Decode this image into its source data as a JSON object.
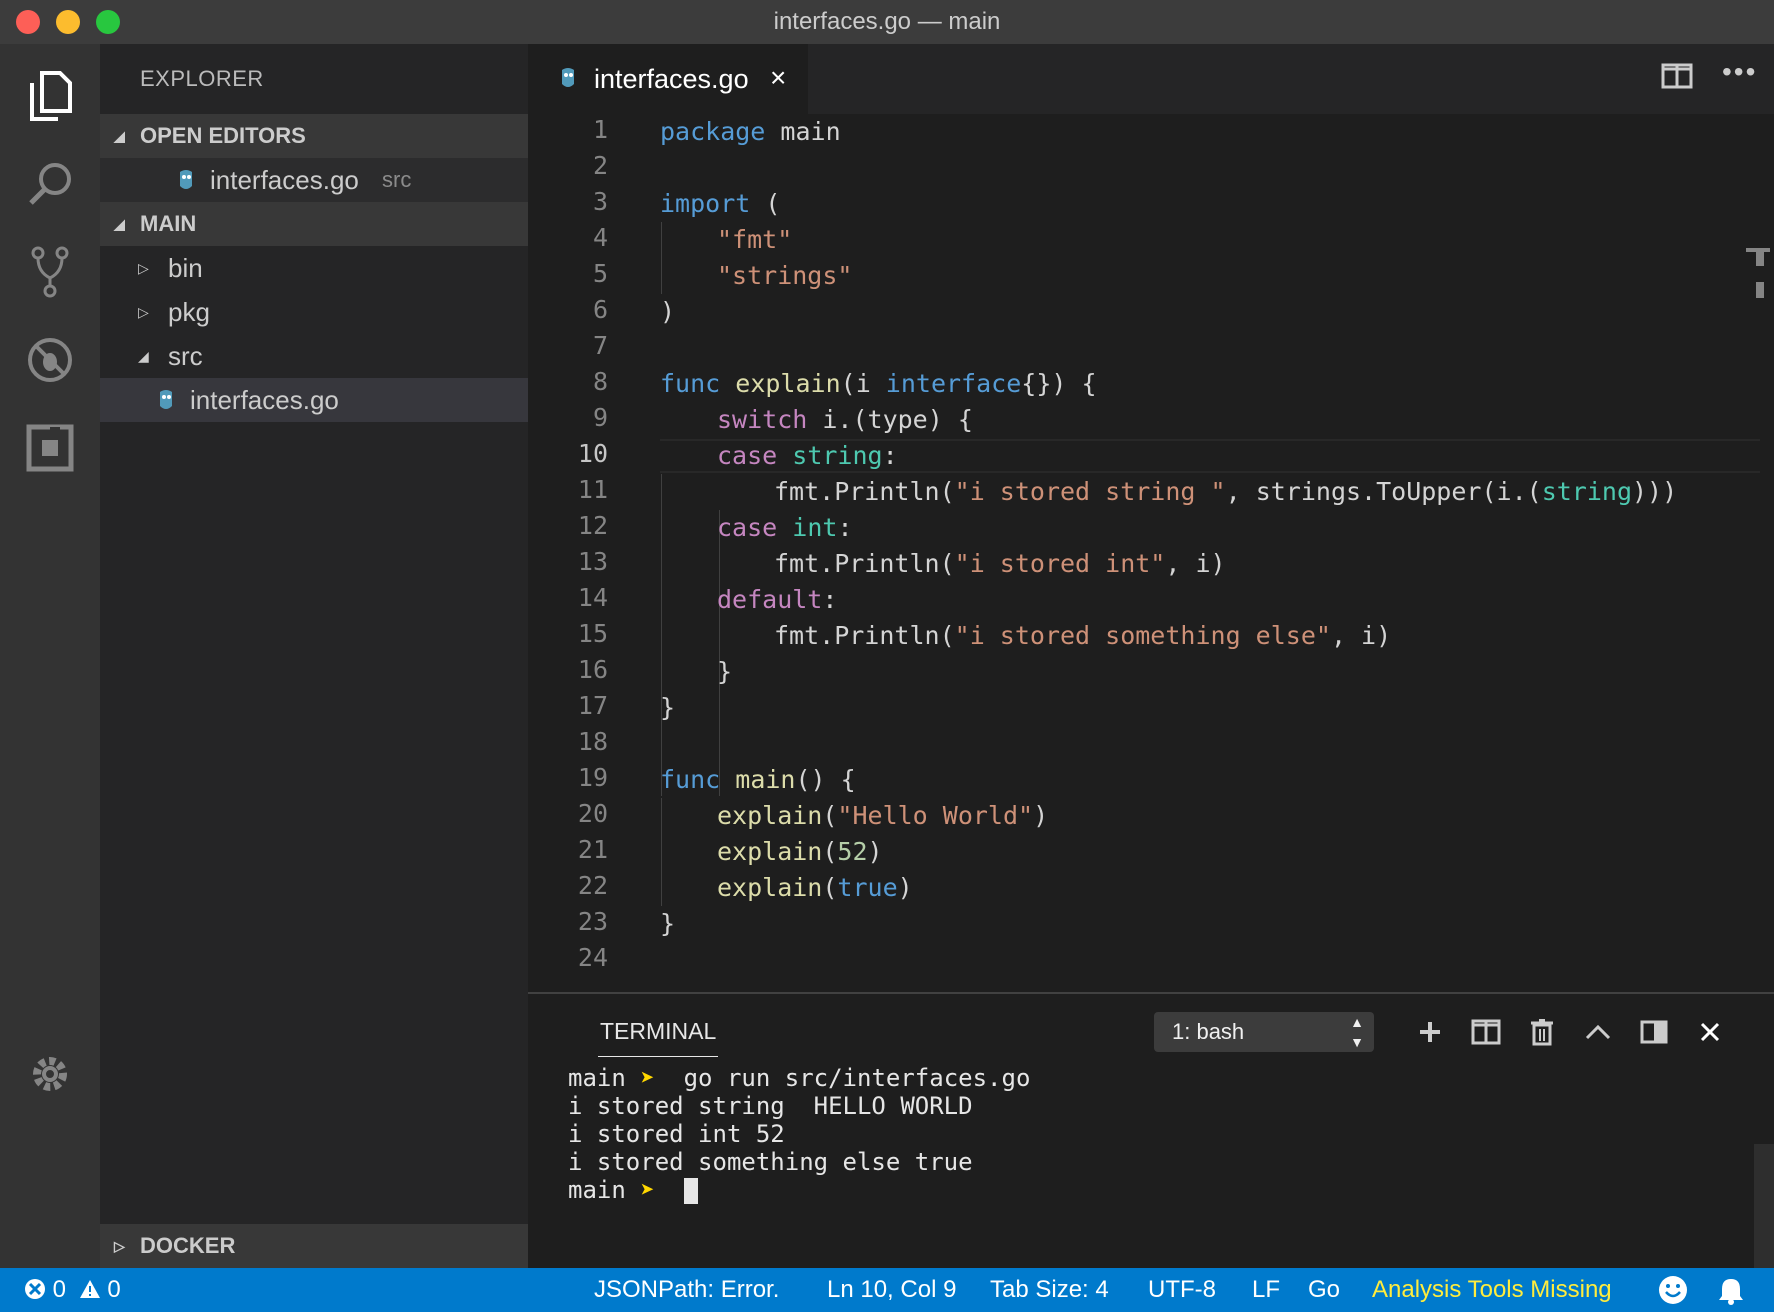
{
  "window": {
    "title": "interfaces.go — main"
  },
  "activity_bar": {
    "items": [
      "files-icon",
      "search-icon",
      "source-control-icon",
      "debug-icon",
      "extensions-icon"
    ],
    "bottom": "gear-icon"
  },
  "sidebar": {
    "title": "EXPLORER",
    "open_editors": {
      "label": "OPEN EDITORS",
      "items": [
        {
          "name": "interfaces.go",
          "folder": "src"
        }
      ]
    },
    "main": {
      "label": "MAIN",
      "items": [
        {
          "name": "bin"
        },
        {
          "name": "pkg"
        },
        {
          "name": "src"
        },
        {
          "name": "interfaces.go"
        }
      ]
    },
    "docker": {
      "label": "DOCKER"
    }
  },
  "editor": {
    "tab": {
      "label": "interfaces.go",
      "close": "×"
    },
    "line_numbers": [
      "1",
      "2",
      "3",
      "4",
      "5",
      "6",
      "7",
      "8",
      "9",
      "10",
      "11",
      "12",
      "13",
      "14",
      "15",
      "16",
      "17",
      "18",
      "19",
      "20",
      "21",
      "22",
      "23",
      "24"
    ],
    "code": [
      "package main",
      "",
      "import (",
      "\"fmt\"",
      "\"strings\"",
      ")",
      "",
      "func explain(i interface{}) {",
      "switch i.(type) {",
      "case string:",
      "fmt.Println(\"i stored string \", strings.ToUpper(i.(string)))",
      "case int:",
      "fmt.Println(\"i stored int\", i)",
      "default:",
      "fmt.Println(\"i stored something else\", i)",
      "}",
      "}",
      "",
      "func main() {",
      "explain(\"Hello World\")",
      "explain(52)",
      "explain(true)",
      "}",
      ""
    ],
    "tokens": {
      "package": "package",
      "main": "main",
      "import": "import",
      "func": "func",
      "explain": "explain",
      "interface": "interface",
      "switch": "switch",
      "case": "case",
      "default": "default",
      "string": "string",
      "int": "int",
      "true": "true",
      "fmt_str": "\"fmt\"",
      "strings_str": "\"strings\"",
      "s_string": "\"i stored string \"",
      "s_int": "\"i stored int\"",
      "s_else": "\"i stored something else\"",
      "s_hello": "\"Hello World\"",
      "n52": "52",
      "println": "fmt.Println",
      "toupper": "strings.ToUpper",
      "main_fn": "main"
    }
  },
  "panel": {
    "tab": "TERMINAL",
    "shell_select": "1: bash",
    "terminal_lines": [
      {
        "prompt": "main",
        "arrow": "➤",
        "cmd": "go run src/interfaces.go"
      },
      {
        "text": "i stored string  HELLO WORLD"
      },
      {
        "text": "i stored int 52"
      },
      {
        "text": "i stored something else true"
      },
      {
        "prompt": "main",
        "arrow": "➤",
        "cmd": ""
      }
    ]
  },
  "statusbar": {
    "errors": "0",
    "warnings": "0",
    "jsonpath": "JSONPath: Error.",
    "position": "Ln 10, Col 9",
    "tab_size": "Tab Size: 4",
    "encoding": "UTF-8",
    "eol": "LF",
    "language": "Go",
    "analysis": "Analysis Tools Missing"
  },
  "colors": {
    "status_bar": "#007acc",
    "keyword": "#569cd6",
    "control": "#c586c0",
    "string": "#ce9178",
    "function": "#dcdcaa",
    "type": "#4ec9b0",
    "warning_text": "#ffec3d"
  }
}
